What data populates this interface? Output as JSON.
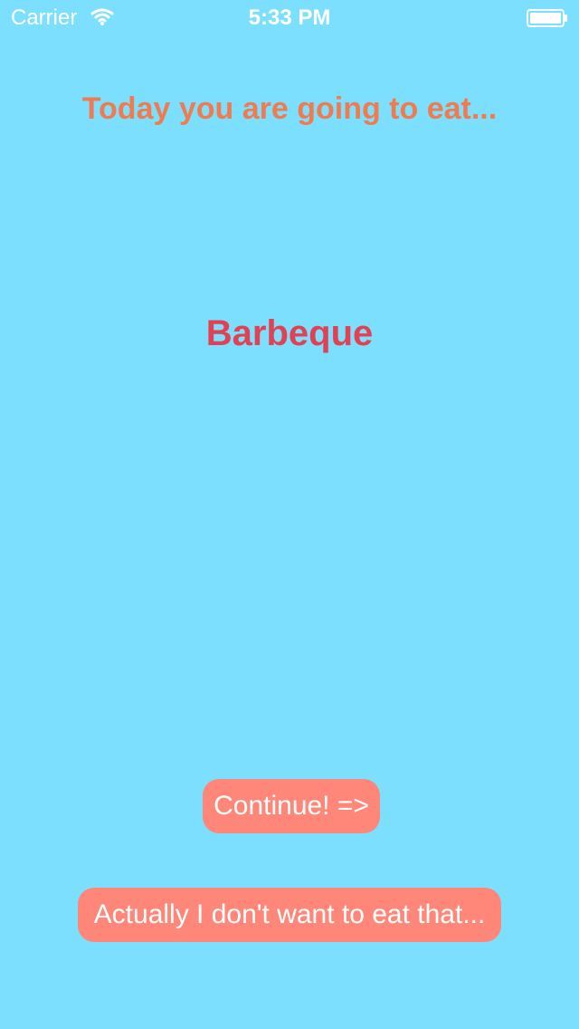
{
  "status_bar": {
    "carrier": "Carrier",
    "time": "5:33 PM"
  },
  "screen": {
    "title": "Today you are going to eat...",
    "food_name": "Barbeque"
  },
  "actions": {
    "continue_label": "Continue! =>",
    "reject_label": "Actually I don't want to eat that..."
  },
  "colors": {
    "background": "#7ddffe",
    "title": "#f07b50",
    "food_name": "#e14152",
    "button_background": "#ff8779",
    "button_text": "#ffffff"
  }
}
